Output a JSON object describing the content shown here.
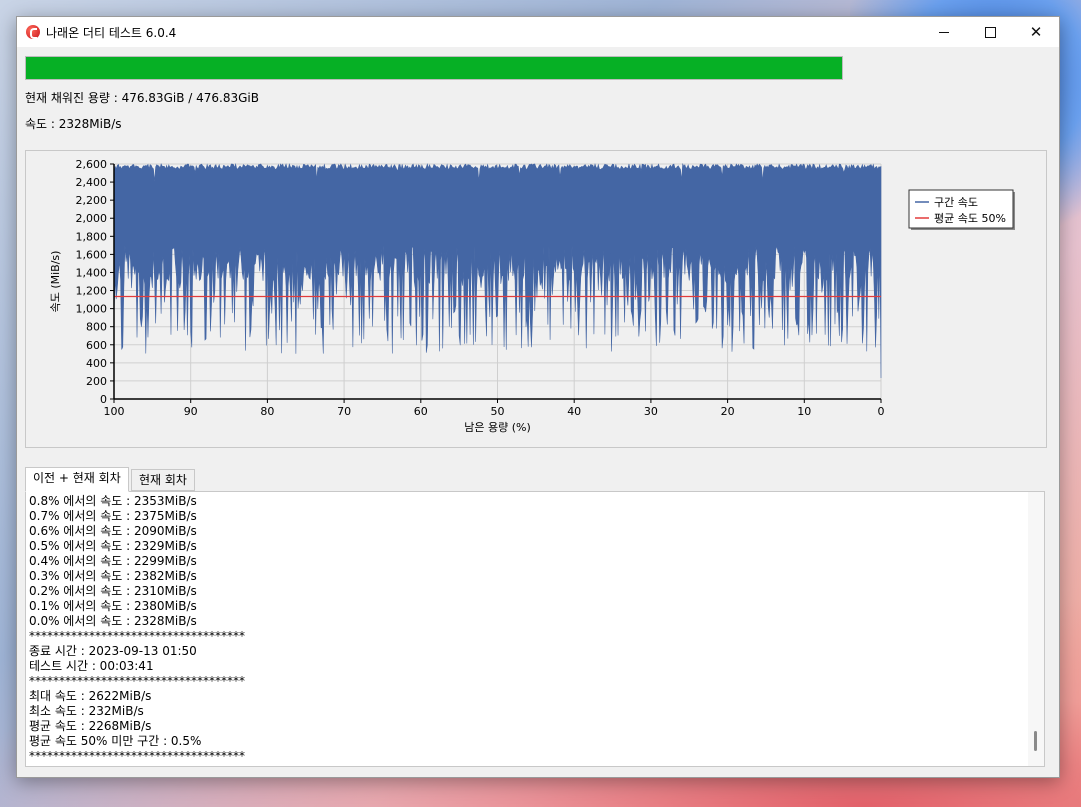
{
  "window": {
    "title": "나래온 더티 테스트 6.0.4"
  },
  "progress": {
    "percent": 100
  },
  "status": {
    "filled_capacity": "현재 채워진 용량 : 476.83GiB / 476.83GiB",
    "speed": "속도 : 2328MiB/s"
  },
  "chart_data": {
    "type": "area",
    "xlabel": "남은 용량 (%)",
    "ylabel": "속도 (MiB/s)",
    "xlim": [
      100,
      0
    ],
    "ylim": [
      0,
      2600
    ],
    "x_ticks": [
      "100",
      "90",
      "80",
      "70",
      "60",
      "50",
      "40",
      "30",
      "20",
      "10",
      "0"
    ],
    "y_ticks": [
      "0",
      "200",
      "400",
      "600",
      "800",
      "1,000",
      "1,200",
      "1,400",
      "1,600",
      "1,800",
      "2,000",
      "2,200",
      "2,400",
      "2,600"
    ],
    "grid": true,
    "legend_position": "right",
    "series": [
      {
        "name": "구간 속도",
        "type": "area",
        "color": "#4466a4",
        "summary": {
          "typical_max": 2600,
          "typical_min": 500,
          "min": 232,
          "max": 2622
        }
      },
      {
        "name": "평균 속도 50%",
        "type": "line",
        "color": "#e23b3b",
        "value": 1134
      }
    ]
  },
  "tabs": [
    {
      "label": "이전 + 현재 회차",
      "active": true
    },
    {
      "label": "현재 회차",
      "active": false
    }
  ],
  "log": [
    "0.8% 에서의 속도 : 2353MiB/s",
    "0.7% 에서의 속도 : 2375MiB/s",
    "0.6% 에서의 속도 : 2090MiB/s",
    "0.5% 에서의 속도 : 2329MiB/s",
    "0.4% 에서의 속도 : 2299MiB/s",
    "0.3% 에서의 속도 : 2382MiB/s",
    "0.2% 에서의 속도 : 2310MiB/s",
    "0.1% 에서의 속도 : 2380MiB/s",
    "0.0% 에서의 속도 : 2328MiB/s",
    "************************************",
    "종료 시간 : 2023-09-13 01:50",
    "테스트 시간 : 00:03:41",
    "************************************",
    "최대 속도 : 2622MiB/s",
    "최소 속도 : 232MiB/s",
    "평균 속도 : 2268MiB/s",
    "평균 속도 50% 미만 구간 : 0.5%",
    "************************************"
  ]
}
